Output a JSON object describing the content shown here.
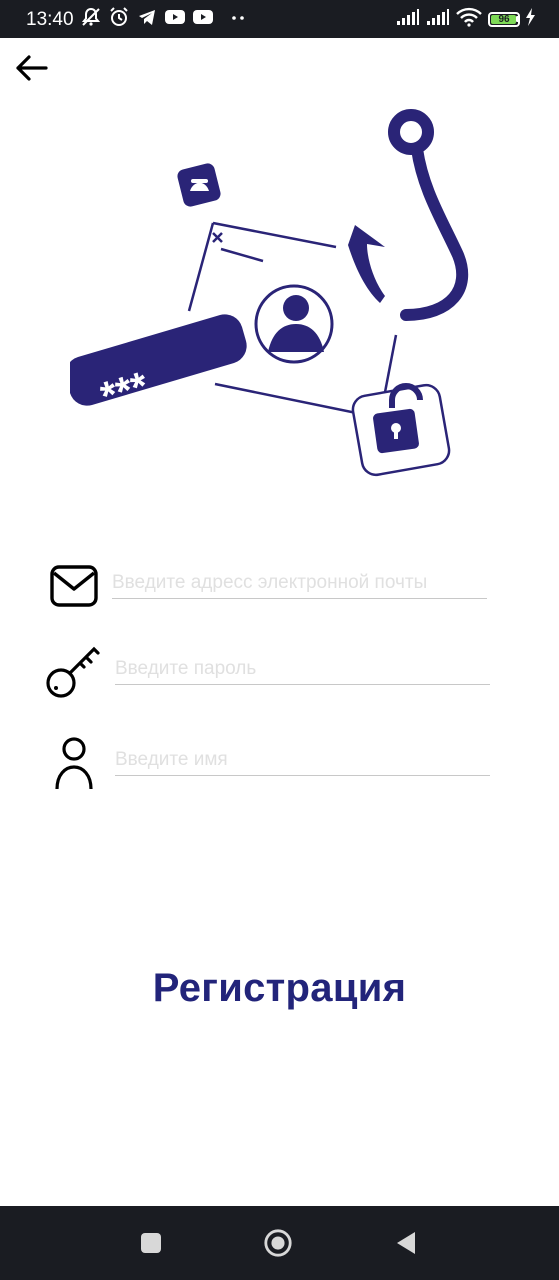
{
  "status_bar": {
    "time": "13:40",
    "battery_level": 96,
    "battery_label": "96",
    "icons_left": [
      "muted-bell-icon",
      "alarm-icon",
      "telegram-icon",
      "youtube-icon",
      "youtube-icon",
      "more-dots-icon"
    ],
    "icons_right": [
      "signal-icon",
      "signal-icon",
      "wifi-icon",
      "battery-icon",
      "charging-icon"
    ]
  },
  "header": {
    "back_icon": "arrow-left-icon"
  },
  "illustration": {
    "name": "phishing-login-illustration",
    "password_mask": "***"
  },
  "form": {
    "email": {
      "icon": "envelope-icon",
      "value": "",
      "placeholder": "Введите адресс электронной почты"
    },
    "password": {
      "icon": "key-icon",
      "value": "",
      "placeholder": "Введите пароль"
    },
    "name": {
      "icon": "person-icon",
      "value": "",
      "placeholder": "Введите имя"
    }
  },
  "register_button": {
    "label": "Регистрация"
  },
  "nav_bar": {
    "icons": [
      "recent-apps-icon",
      "home-icon",
      "back-triangle-icon"
    ]
  },
  "colors": {
    "accent": "#2a2477",
    "button_text": "#22247a",
    "system_bar": "#1a1c22",
    "battery": "#7ed957"
  }
}
